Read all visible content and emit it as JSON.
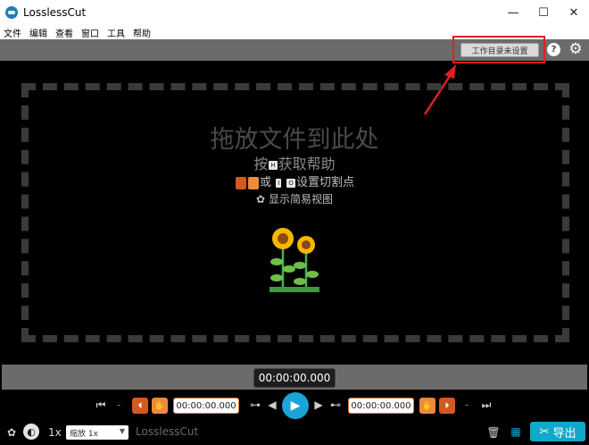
{
  "window": {
    "title": "LosslessCut",
    "minimize": "—",
    "maximize": "☐",
    "close": "✕"
  },
  "menu": [
    "文件",
    "编辑",
    "查看",
    "窗口",
    "工具",
    "帮助"
  ],
  "toolbar": {
    "working_dir_label": "工作目录未设置",
    "help_label": "?",
    "settings_icon": "gear-icon"
  },
  "dropzone": {
    "title": "拖放文件到此处",
    "help_prefix": "按",
    "help_key": "H",
    "help_suffix": "获取帮助",
    "cut_or": "或",
    "cut_key_i": "I",
    "cut_key_o": "O",
    "cut_suffix": "设置切割点",
    "simple_view": "显示简易视图"
  },
  "timeline": {
    "current_time": "00:00:00.000"
  },
  "controls": {
    "start_time": "00:00:00.000",
    "end_time": "00:00:00.000",
    "dash": "-"
  },
  "bottom": {
    "speed": "1x",
    "zoom": "缩放 1x",
    "brand": "LosslessCut",
    "export_label": "导出"
  },
  "colors": {
    "accent_blue": "#1aa4d8",
    "export_teal": "#11a9c9",
    "cut_orange": "#d35a1f",
    "highlight_red": "#e02020"
  }
}
